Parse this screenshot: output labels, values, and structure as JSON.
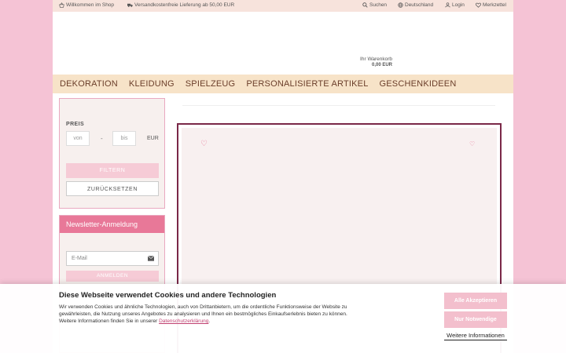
{
  "topbar": {
    "welcome": "Willkommen im Shop",
    "shipping": "Versandkostenfreie Lieferung ab 50,00 EUR",
    "search": "Suchen",
    "country": "Deutschland",
    "login": "Login",
    "wishlist": "Merkzettel"
  },
  "cart": {
    "label": "Ihr Warenkorb",
    "amount": "0,00 EUR"
  },
  "nav": [
    "DEKORATION",
    "KLEIDUNG",
    "SPIELZEUG",
    "PERSONALISIERTE ARTIKEL",
    "GESCHENKIDEEN"
  ],
  "filter": {
    "price_label": "PREIS",
    "from_placeholder": "von",
    "to_placeholder": "bis",
    "separator": "-",
    "currency": "EUR",
    "filter_btn": "FILTERN",
    "reset_btn": "ZURÜCKSETZEN"
  },
  "newsletter": {
    "title": "Newsletter-Anmeldung",
    "email_placeholder": "E-Mail",
    "subscribe_btn": "ANMELDEN"
  },
  "cookie": {
    "title": "Diese Webseite verwendet Cookies und andere Technologien",
    "text": "Wir verwenden Cookies und ähnliche Technologien, auch von Drittanbietern, um die ordentliche Funktionsweise der Website zu gewährleisten, die Nutzung unseres Angebotes zu analysieren und Ihnen ein bestmögliches Einkaufserlebnis bieten zu können. Weitere Informationen finden Sie in unserer",
    "privacy_link": "Datenschutzerklärung",
    "accept_all": "Alle Akzeptieren",
    "necessary_only": "Nur Notwendige",
    "more_info": "Weitere Informationen"
  }
}
